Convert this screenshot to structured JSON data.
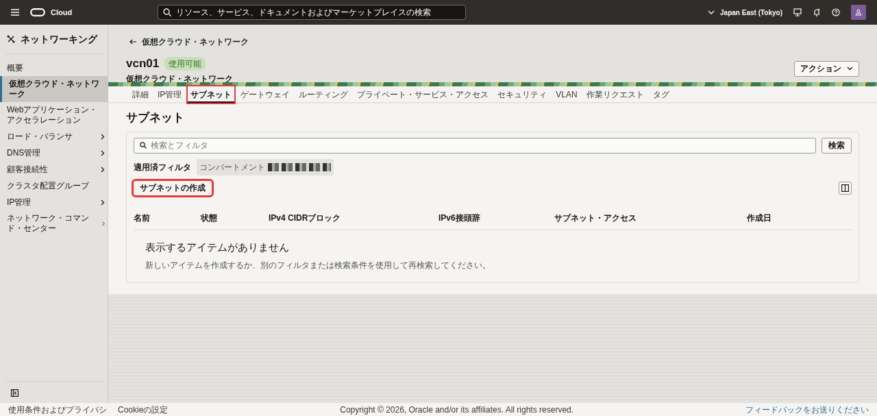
{
  "topbar": {
    "brand": "Cloud",
    "search_placeholder": "リソース、サービス、ドキュメントおよびマーケットプレイスの検索",
    "region": "Japan East (Tokyo)"
  },
  "sidebar": {
    "title": "ネットワーキング",
    "items": [
      {
        "label": "概要",
        "selected": false,
        "expandable": false
      },
      {
        "label": "仮想クラウド・ネットワーク",
        "selected": true,
        "expandable": false
      },
      {
        "label": "Webアプリケーション・アクセラレーション",
        "selected": false,
        "expandable": false
      },
      {
        "label": "ロード・バランサ",
        "selected": false,
        "expandable": true
      },
      {
        "label": "DNS管理",
        "selected": false,
        "expandable": true
      },
      {
        "label": "顧客接続性",
        "selected": false,
        "expandable": true
      },
      {
        "label": "クラスタ配置グループ",
        "selected": false,
        "expandable": false
      },
      {
        "label": "IP管理",
        "selected": false,
        "expandable": true
      },
      {
        "label": "ネットワーク・コマンド・センター",
        "selected": false,
        "expandable": true
      }
    ]
  },
  "header": {
    "back_link": "仮想クラウド・ネットワーク",
    "title": "vcn01",
    "status": "使用可能",
    "subtitle": "仮想クラウド・ネットワーク",
    "actions_button": "アクション"
  },
  "tabs": [
    {
      "label": "詳細",
      "selected": false,
      "highlighted": false
    },
    {
      "label": "IP管理",
      "selected": false,
      "highlighted": false
    },
    {
      "label": "サブネット",
      "selected": true,
      "highlighted": true
    },
    {
      "label": "ゲートウェイ",
      "selected": false,
      "highlighted": false
    },
    {
      "label": "ルーティング",
      "selected": false,
      "highlighted": false
    },
    {
      "label": "プライベート・サービス・アクセス",
      "selected": false,
      "highlighted": false
    },
    {
      "label": "セキュリティ",
      "selected": false,
      "highlighted": false
    },
    {
      "label": "VLAN",
      "selected": false,
      "highlighted": false
    },
    {
      "label": "作業リクエスト",
      "selected": false,
      "highlighted": false
    },
    {
      "label": "タグ",
      "selected": false,
      "highlighted": false
    }
  ],
  "section": {
    "title": "サブネット",
    "search_placeholder": "検索とフィルタ",
    "search_button": "検索",
    "applied_filters_label": "適用済フィルタ",
    "filter_chip": "コンパートメント",
    "create_button": {
      "label": "サブネットの作成",
      "highlighted": true
    },
    "table": {
      "columns": [
        "名前",
        "状態",
        "IPv4 CIDRブロック",
        "IPv6接頭辞",
        "サブネット・アクセス",
        "作成日"
      ],
      "empty_title": "表示するアイテムがありません",
      "empty_message": "新しいアイテムを作成するか、別のフィルタまたは検索条件を使用して再検索してください。"
    }
  },
  "footer": {
    "links": [
      "使用条件およびプライバシ",
      "Cookieの設定"
    ],
    "copyright": "Copyright © 2026, Oracle and/or its affiliates. All rights reserved.",
    "feedback_link": "フィードバックをお送りください"
  }
}
